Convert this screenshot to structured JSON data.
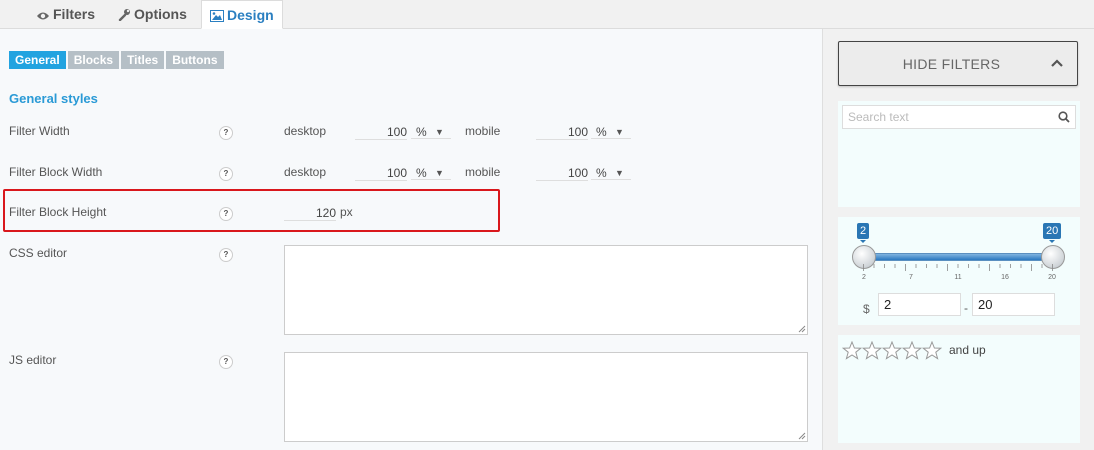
{
  "tabs": [
    {
      "label": "Filters",
      "icon": "eye-icon"
    },
    {
      "label": "Options",
      "icon": "wrench-icon"
    },
    {
      "label": "Design",
      "icon": "image-icon"
    }
  ],
  "subtabs": [
    "General",
    "Blocks",
    "Titles",
    "Buttons"
  ],
  "section_title": "General styles",
  "rows": {
    "filter_width": {
      "label": "Filter Width",
      "desktop_label": "desktop",
      "desktop_value": "100",
      "desktop_unit": "%",
      "mobile_label": "mobile",
      "mobile_value": "100",
      "mobile_unit": "%"
    },
    "filter_block_width": {
      "label": "Filter Block Width",
      "desktop_label": "desktop",
      "desktop_value": "100",
      "desktop_unit": "%",
      "mobile_label": "mobile",
      "mobile_value": "100",
      "mobile_unit": "%"
    },
    "filter_block_height": {
      "label": "Filter Block Height",
      "value": "120",
      "unit": "px"
    },
    "css_editor": {
      "label": "CSS editor",
      "value": ""
    },
    "js_editor": {
      "label": "JS editor",
      "value": ""
    }
  },
  "help_glyph": "?",
  "preview": {
    "hide_filters_label": "HIDE FILTERS",
    "search_placeholder": "Search text",
    "slider": {
      "min_bubble": "2",
      "max_bubble": "20",
      "tick_labels": [
        "2",
        "7",
        "11",
        "16",
        "20"
      ],
      "currency": "$",
      "from_value": "2",
      "separator": "-",
      "to_value": "20"
    },
    "rating": {
      "stars": 5,
      "filled": 0,
      "suffix": "and up"
    }
  },
  "colors": {
    "accent": "#22a3e0",
    "highlight": "#d9171c",
    "slider": "#2a76b4",
    "preview_bg": "#f3fdfd"
  }
}
